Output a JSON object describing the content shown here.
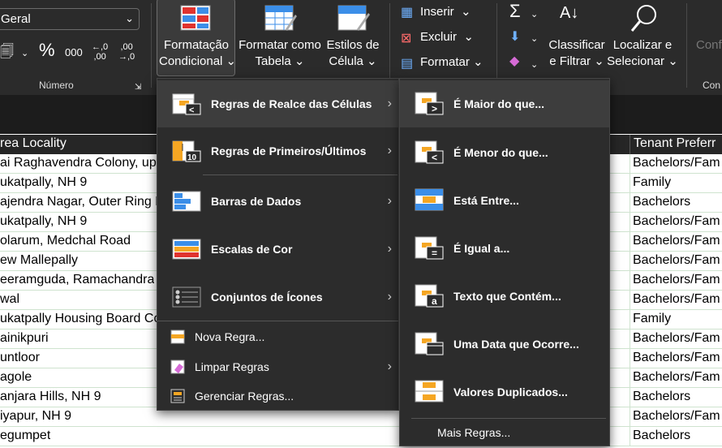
{
  "ribbon": {
    "number_format": "Geral",
    "number_group_label": "Número",
    "percent_symbol": "%",
    "thousands_symbol": "000",
    "inc_decimal": "←,0\n,00",
    "dec_decimal": ",00\n→,0",
    "cond_format": {
      "line1": "Formatação",
      "line2": "Condicional"
    },
    "format_table": {
      "line1": "Formatar como",
      "line2": "Tabela"
    },
    "cell_styles": {
      "line1": "Estilos de",
      "line2": "Célula"
    },
    "insert": "Inserir",
    "delete": "Excluir",
    "format": "Formatar",
    "sort_filter": {
      "line1": "Classificar",
      "line2": "e Filtrar"
    },
    "find_select": {
      "line1": "Localizar e",
      "line2": "Selecionar"
    },
    "conf_partial": "Conf",
    "con_partial": "Con"
  },
  "grid": {
    "header_left": "rea Locality",
    "header_right": "Tenant Preferr",
    "rows": [
      {
        "left": "ai Raghavendra Colony, upp",
        "right": "Bachelors/Fam"
      },
      {
        "left": "ukatpally, NH 9",
        "right": "Family"
      },
      {
        "left": "ajendra Nagar, Outer Ring R",
        "right": "Bachelors"
      },
      {
        "left": "ukatpally, NH 9",
        "right": "Bachelors/Fam"
      },
      {
        "left": "olarum, Medchal Road",
        "right": "Bachelors/Fam"
      },
      {
        "left": "ew Mallepally",
        "right": "Bachelors/Fam"
      },
      {
        "left": "eeramguda, Ramachandra",
        "right": "Bachelors/Fam"
      },
      {
        "left": "wal",
        "right": "Bachelors/Fam"
      },
      {
        "left": "ukatpally Housing Board Co",
        "right": "Family"
      },
      {
        "left": "ainikpuri",
        "right": "Bachelors/Fam"
      },
      {
        "left": "untloor",
        "right": "Bachelors/Fam"
      },
      {
        "left": "agole",
        "right": "Bachelors/Fam"
      },
      {
        "left": "anjara Hills, NH 9",
        "right": "Bachelors"
      },
      {
        "left": "iyapur, NH 9",
        "right": "Bachelors/Fam"
      },
      {
        "left": "egumpet",
        "right": "Bachelors"
      }
    ]
  },
  "menu": {
    "items": [
      {
        "label": "Regras de Realce das Células"
      },
      {
        "label": "Regras de Primeiros/Últimos"
      },
      {
        "label": "Barras de Dados"
      },
      {
        "label": "Escalas de Cor"
      },
      {
        "label": "Conjuntos de Ícones"
      }
    ],
    "small_items": [
      {
        "label": "Nova Regra..."
      },
      {
        "label": "Limpar Regras"
      },
      {
        "label": "Gerenciar Regras..."
      }
    ]
  },
  "submenu": {
    "items": [
      {
        "label": "É Maior do que..."
      },
      {
        "label": "É Menor do que..."
      },
      {
        "label": "Está Entre..."
      },
      {
        "label": "É Igual a..."
      },
      {
        "label": "Texto que Contém..."
      },
      {
        "label": "Uma Data que Ocorre..."
      },
      {
        "label": "Valores Duplicados..."
      }
    ],
    "more": "Mais Regras..."
  },
  "colors": {
    "accent_orange": "#f5a623",
    "accent_blue": "#3b8ee8",
    "accent_red": "#e0332f"
  }
}
